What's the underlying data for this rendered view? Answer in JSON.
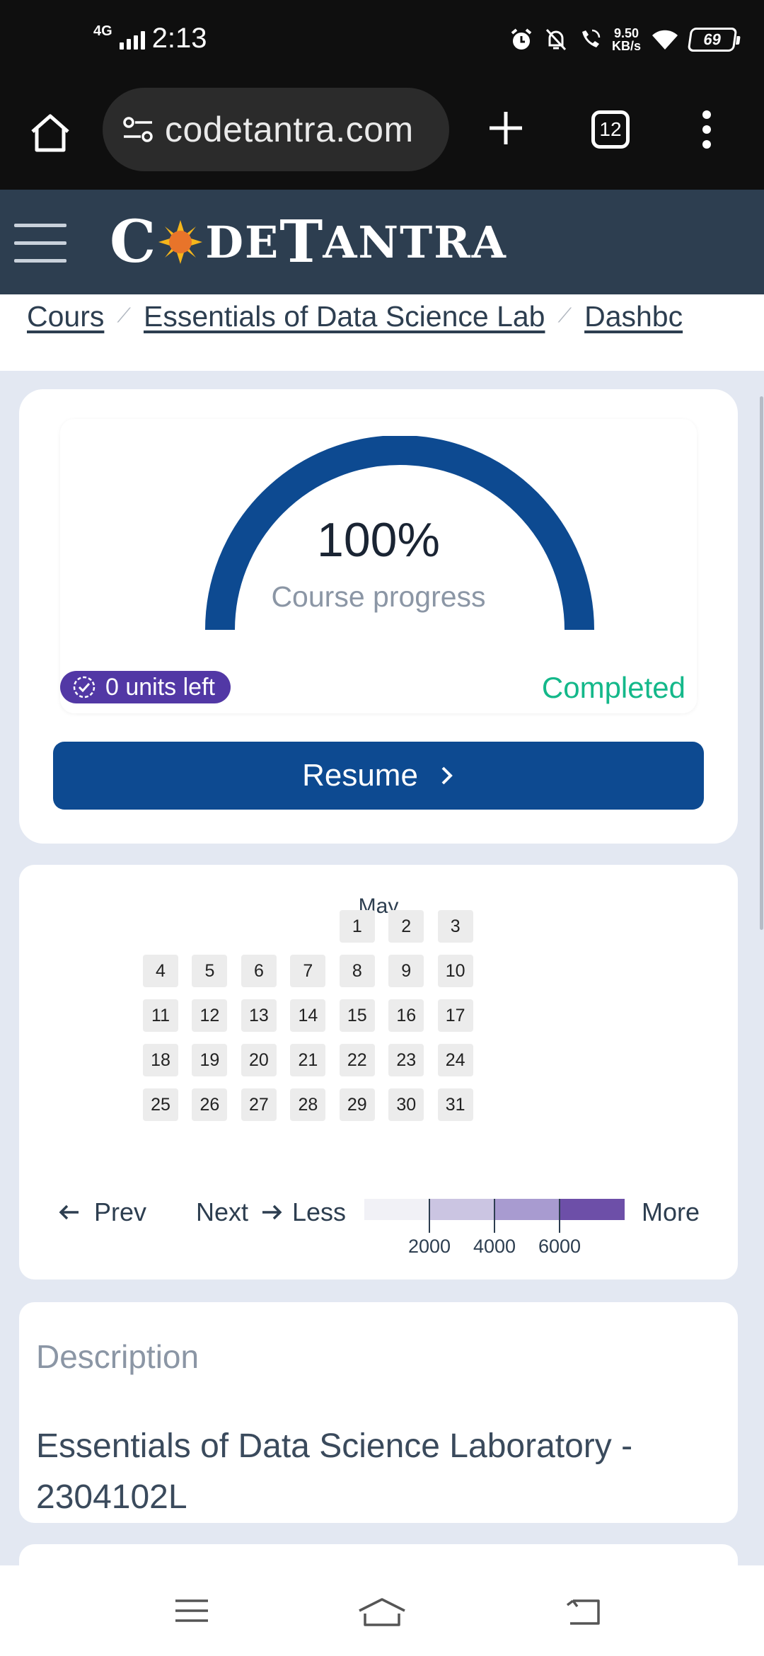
{
  "status_bar": {
    "network": "4G",
    "time": "2:13",
    "speed_value": "9.50",
    "speed_unit": "KB/s",
    "battery": "69"
  },
  "browser": {
    "url": "codetantra.com",
    "tab_count": "12"
  },
  "header": {
    "logo_c": "C",
    "logo_de": "DE",
    "logo_t": "T",
    "logo_antra": "ANTRA"
  },
  "breadcrumb": [
    "Cours",
    "Essentials of Data Science Lab",
    "Dashbc"
  ],
  "progress": {
    "value": 1.0,
    "percent_label": "100%",
    "label": "Course progress",
    "units_left": "0 units left",
    "status": "Completed",
    "resume_label": "Resume",
    "gauge_color": "#0d4a91",
    "status_color": "#14b88a",
    "badge_color": "#5238a5"
  },
  "calendar": {
    "month": "May",
    "prev_label": "Prev",
    "next_label": "Next",
    "less_label": "Less",
    "more_label": "More",
    "legend_ticks": [
      "2000",
      "4000",
      "6000"
    ],
    "legend_colors": [
      "#f1f1f6",
      "#cbc5e2",
      "#a89bd0",
      "#6d4fa8"
    ],
    "rows": [
      [
        "",
        "",
        "",
        "",
        "1",
        "2",
        "3"
      ],
      [
        "4",
        "5",
        "6",
        "7",
        "8",
        "9",
        "10"
      ],
      [
        "11",
        "12",
        "13",
        "14",
        "15",
        "16",
        "17"
      ],
      [
        "18",
        "19",
        "20",
        "21",
        "22",
        "23",
        "24"
      ],
      [
        "25",
        "26",
        "27",
        "28",
        "29",
        "30",
        "31"
      ]
    ]
  },
  "description": {
    "label": "Description",
    "text": "Essentials of Data Science Laboratory - 2304102L"
  }
}
